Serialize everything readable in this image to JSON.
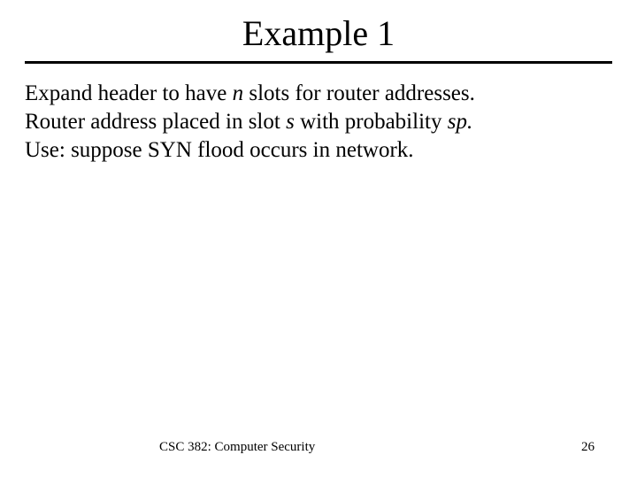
{
  "title": "Example 1",
  "body": {
    "line1a": "Expand header to have ",
    "line1b": "n",
    "line1c": " slots for router addresses.",
    "line2a": "Router address placed in slot ",
    "line2b": "s",
    "line2c": " with probability ",
    "line2d": "sp.",
    "line3": "Use: suppose SYN flood occurs in network."
  },
  "footer": {
    "course": "CSC 382: Computer Security",
    "page": "26"
  }
}
